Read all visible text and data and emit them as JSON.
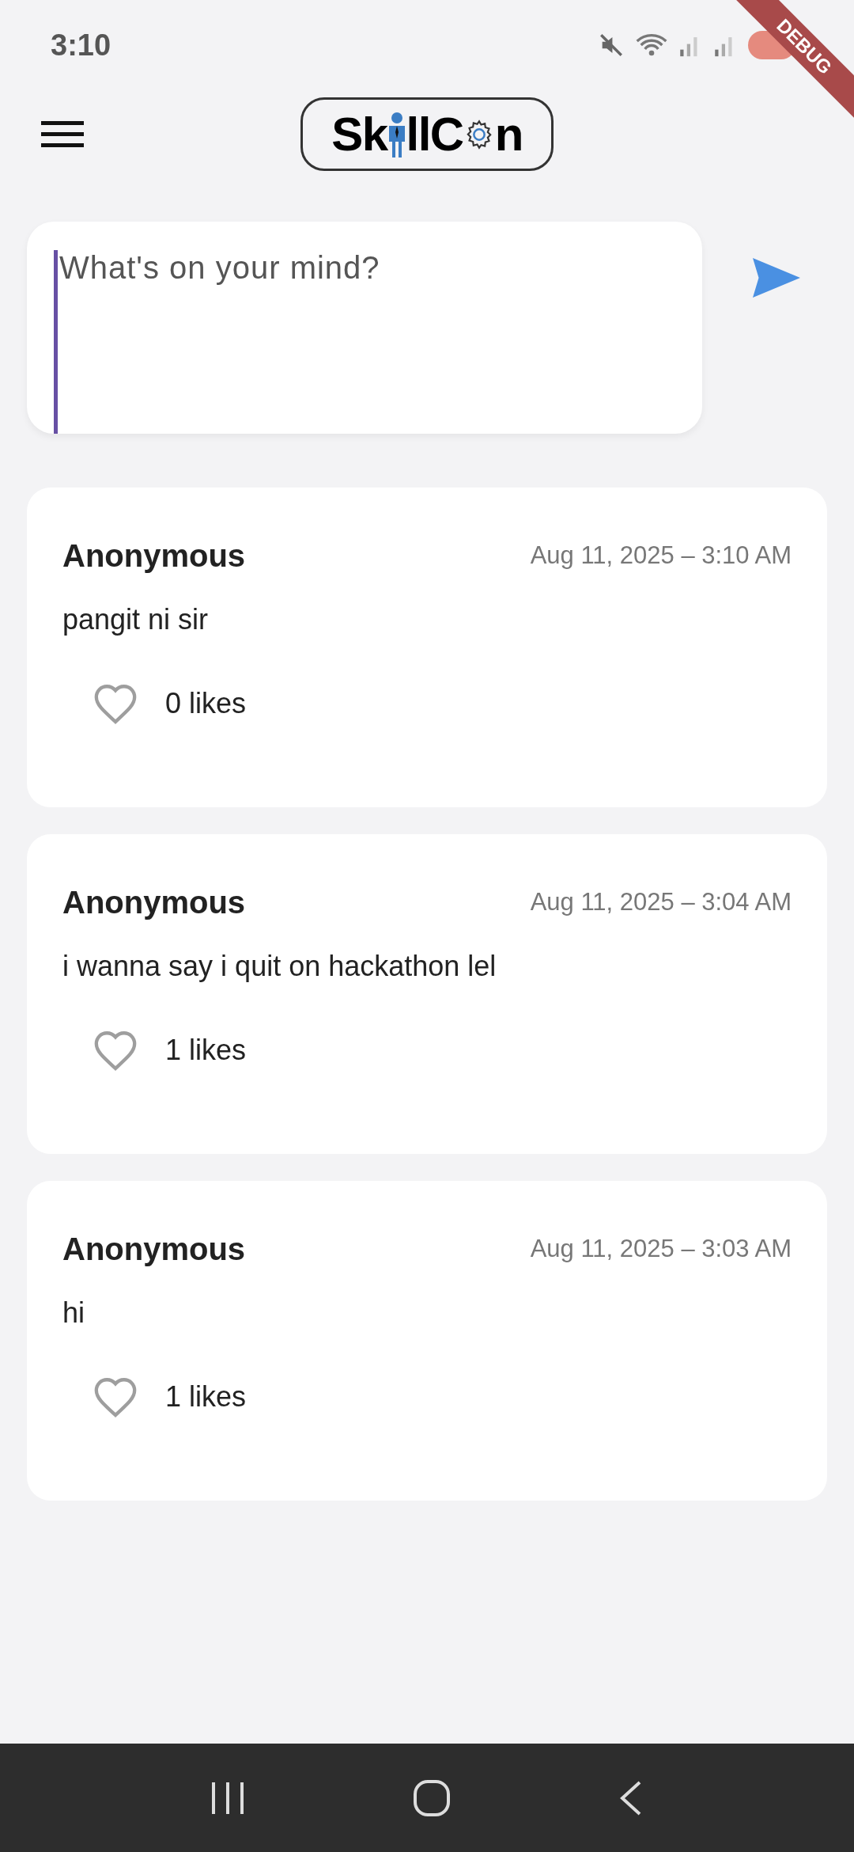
{
  "status_bar": {
    "time": "3:10"
  },
  "debug_banner": "DEBUG",
  "header": {
    "logo_parts": [
      "Sk",
      "llC",
      "n"
    ]
  },
  "composer": {
    "placeholder": "What's on your mind?"
  },
  "posts": [
    {
      "author": "Anonymous",
      "time": "Aug 11, 2025 – 3:10 AM",
      "body": "pangit ni sir",
      "likes": "0 likes",
      "liked": false
    },
    {
      "author": "Anonymous",
      "time": "Aug 11, 2025 – 3:04 AM",
      "body": "i wanna say i quit on hackathon lel",
      "likes": "1 likes",
      "liked": false
    },
    {
      "author": "Anonymous",
      "time": "Aug 11, 2025 – 3:03 AM",
      "body": "hi",
      "likes": "1 likes",
      "liked": false
    }
  ]
}
